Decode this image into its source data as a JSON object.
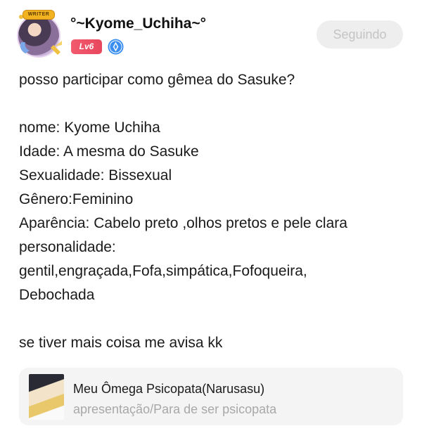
{
  "author": {
    "name": "°~Kyome_Uchiha~°",
    "avatar_badge": "WRITER",
    "level": "Lv6",
    "verified_icon": "verified-icon",
    "follow_label": "Seguindo"
  },
  "post": {
    "lines": [
      "posso participar como gêmea do Sasuke?",
      "",
      "nome: Kyome Uchiha",
      "Idade: A mesma do Sasuke",
      "Sexualidade: Bissexual",
      "Gênero:Feminino",
      "Aparência: Cabelo preto ,olhos pretos e pele clara",
      "personalidade:",
      "gentil,engraçada,Fofa,simpática,Fofoqueira,",
      "Debochada",
      "",
      "se tiver mais coisa me avisa kk"
    ]
  },
  "linked": {
    "title": "Meu Ômega Psicopata(Narusasu)",
    "subtitle": "apresentação/Para de ser psicopata"
  },
  "colors": {
    "level_badge": "#e8475d",
    "verified": "#3b8ff0",
    "follow_bg": "#eeeeee",
    "follow_text": "#c4c4c4",
    "card_bg": "#f4f4f4"
  }
}
